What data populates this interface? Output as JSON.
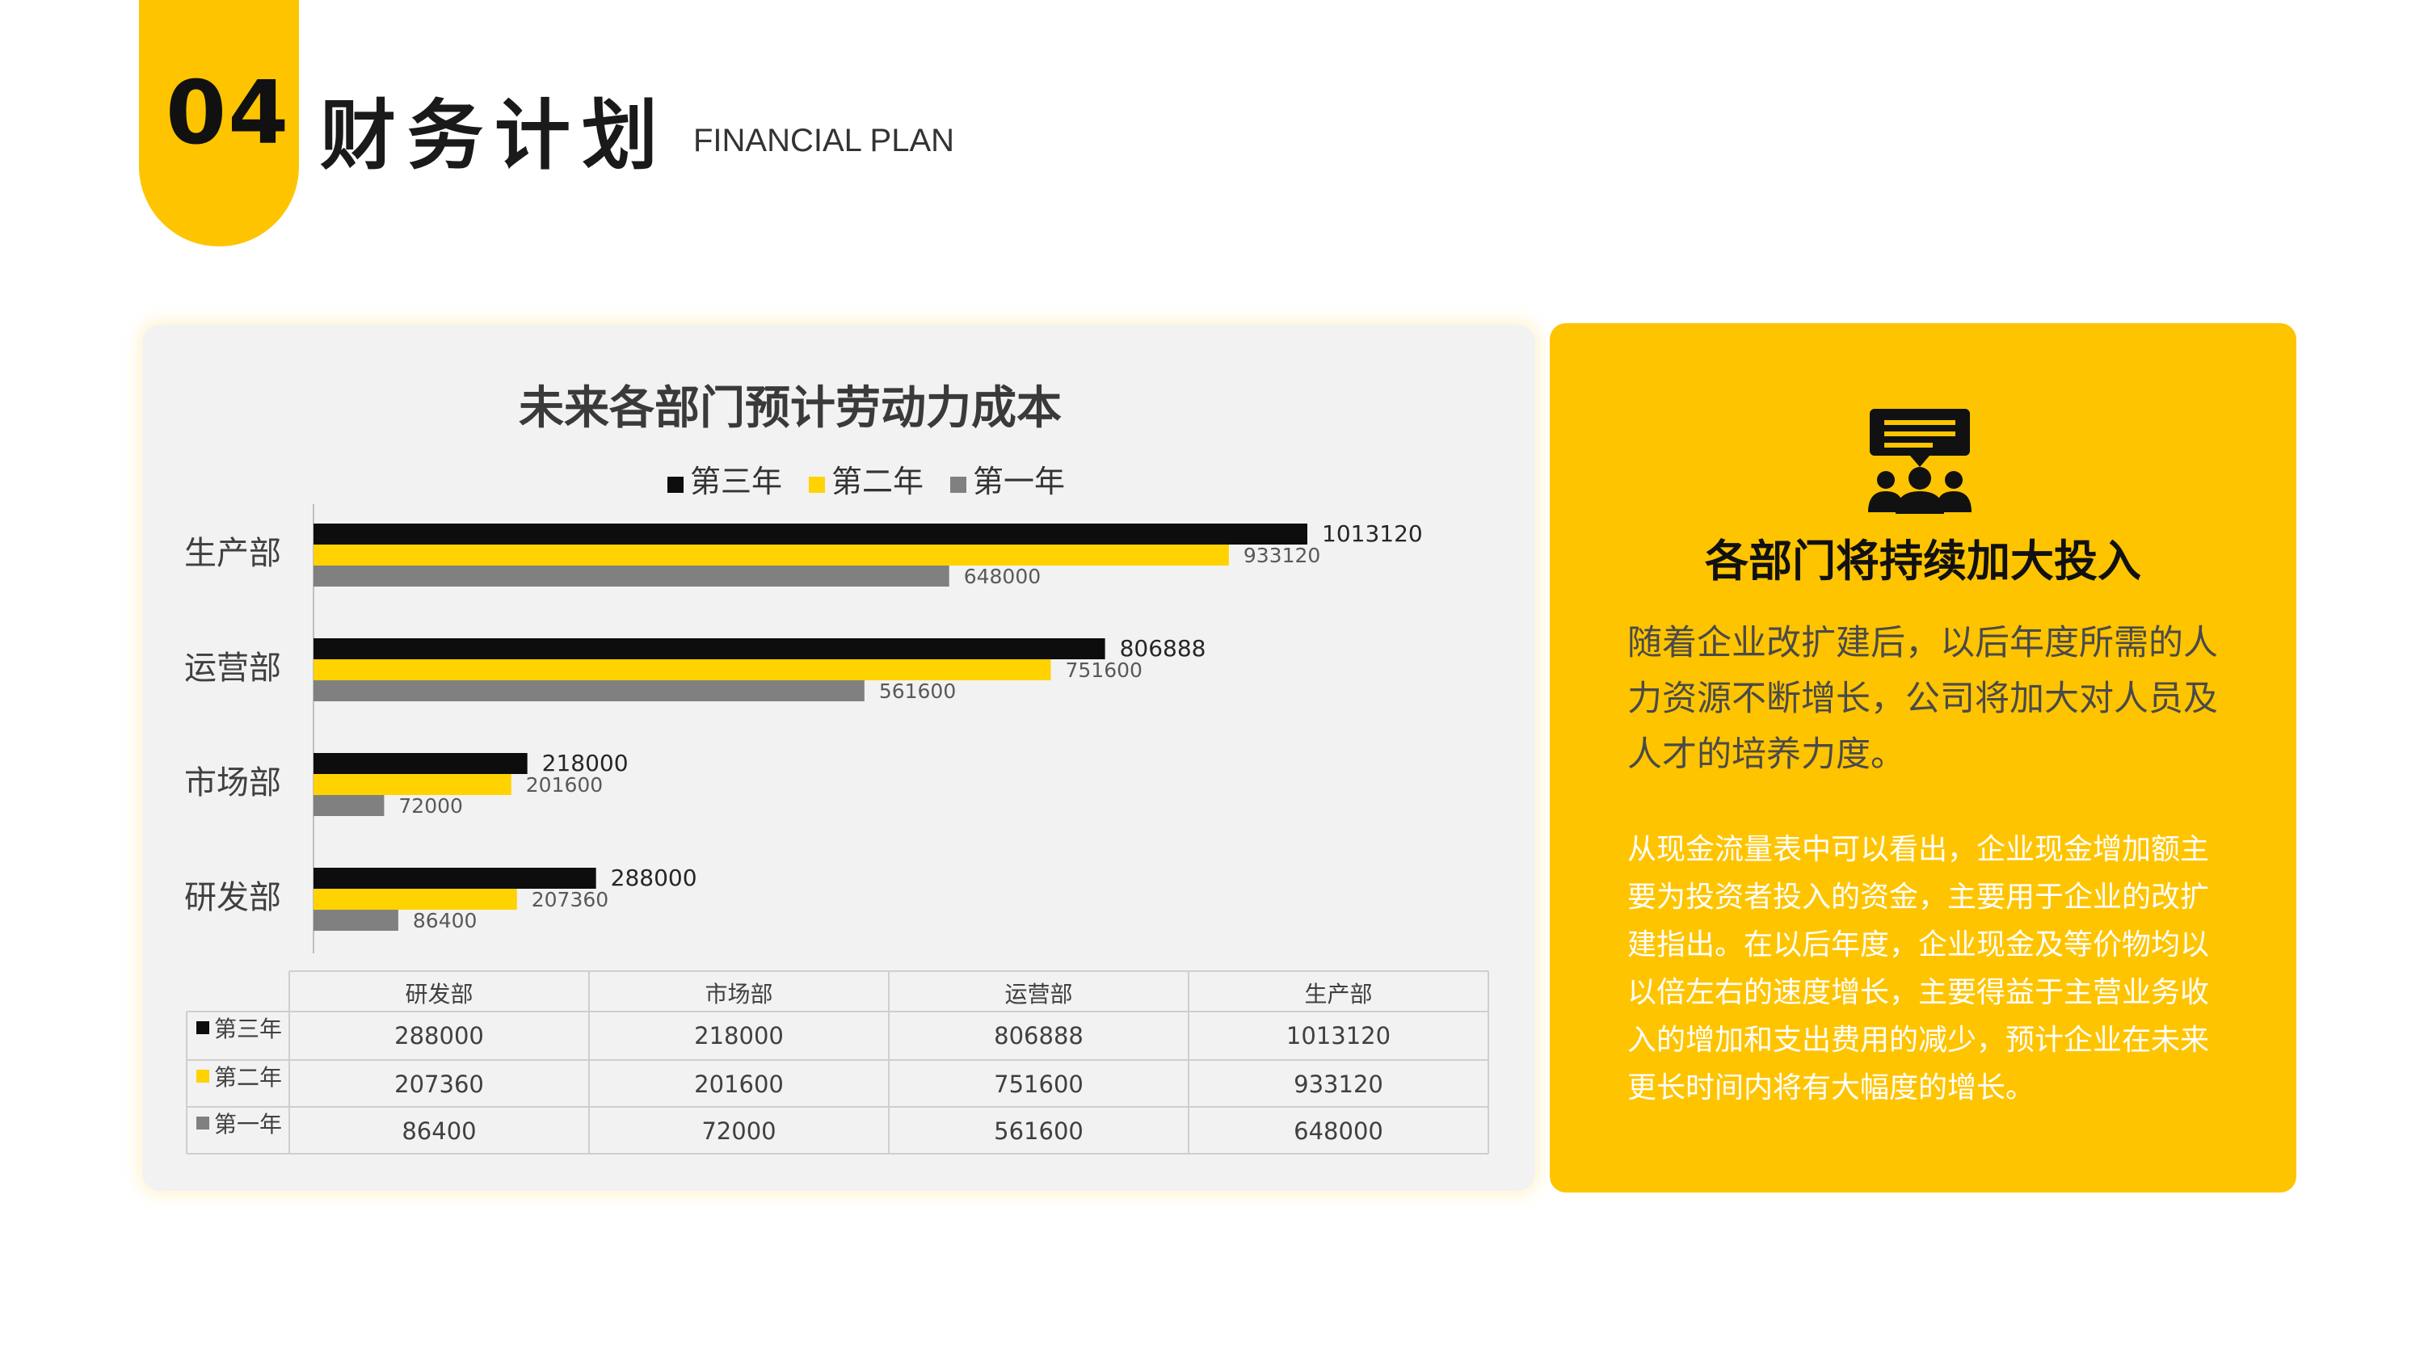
{
  "header": {
    "number": "04",
    "title": "财务计划",
    "subtitle_en": "FINANCIAL PLAN"
  },
  "colors": {
    "accent_yellow": "#FFC400",
    "series_black": "#0D0D0D",
    "series_yellow": "#FFD200",
    "series_gray": "#808080",
    "card_gray": "#F2F2F2"
  },
  "chart_data": {
    "type": "bar",
    "orientation": "horizontal",
    "title": "未来各部门预计劳动力成本",
    "legend_position": "top",
    "categories": [
      "生产部",
      "运营部",
      "市场部",
      "研发部"
    ],
    "series": [
      {
        "name": "第三年",
        "color": "#0D0D0D",
        "values": [
          1013120,
          806888,
          218000,
          288000
        ]
      },
      {
        "name": "第二年",
        "color": "#FFD200",
        "values": [
          933120,
          751600,
          201600,
          207360
        ]
      },
      {
        "name": "第一年",
        "color": "#808080",
        "values": [
          648000,
          561600,
          72000,
          86400
        ]
      }
    ],
    "xlim": [
      0,
      1100000
    ],
    "grid": false,
    "data_table": {
      "columns": [
        "研发部",
        "市场部",
        "运营部",
        "生产部"
      ],
      "rows": [
        {
          "label": "第三年",
          "color": "#0D0D0D",
          "values": [
            "288000",
            "218000",
            "806888",
            "1013120"
          ]
        },
        {
          "label": "第二年",
          "color": "#FFD200",
          "values": [
            "207360",
            "201600",
            "751600",
            "933120"
          ]
        },
        {
          "label": "第一年",
          "color": "#808080",
          "values": [
            "86400",
            "72000",
            "561600",
            "648000"
          ]
        }
      ]
    }
  },
  "info": {
    "icon": "meeting-chat-icon",
    "title": "各部门将持续加大投入",
    "para1": "随着企业改扩建后，以后年度所需的人力资源不断增长，公司将加大对人员及人才的培养力度。",
    "para2": "从现金流量表中可以看出，企业现金增加额主要为投资者投入的资金，主要用于企业的改扩建指出。在以后年度，企业现金及等价物均以以倍左右的速度增长，主要得益于主营业务收入的增加和支出费用的减少，预计企业在未来更长时间内将有大幅度的增长。"
  }
}
